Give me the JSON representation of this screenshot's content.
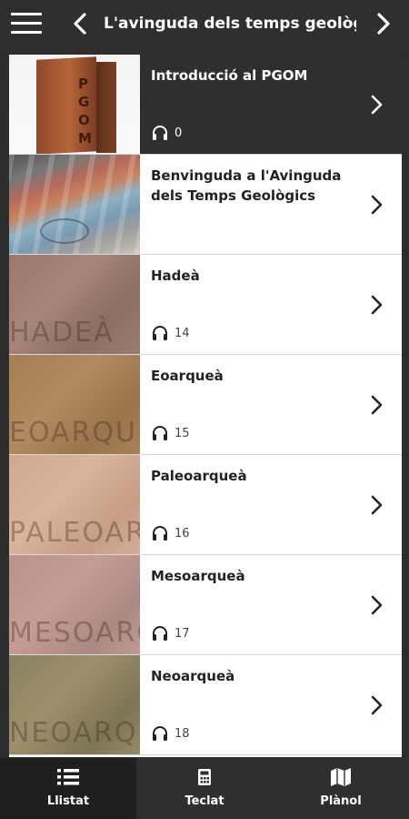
{
  "header": {
    "title": "L'avinguda dels temps geològics"
  },
  "items": [
    {
      "title": "Introducció al PGOM",
      "count": "0",
      "show_audio": true,
      "thumb": "pillar",
      "thumb_text": ""
    },
    {
      "title": "Benvinguda a l'Avinguda dels Temps Geològics",
      "count": "",
      "show_audio": false,
      "thumb": "avenue",
      "thumb_text": ""
    },
    {
      "title": "Hadeà",
      "count": "14",
      "show_audio": true,
      "thumb": "stone1",
      "thumb_text": "HADEÀ"
    },
    {
      "title": "Eoarqueà",
      "count": "15",
      "show_audio": true,
      "thumb": "stone2",
      "thumb_text": "EOARQUEÀ"
    },
    {
      "title": "Paleoarqueà",
      "count": "16",
      "show_audio": true,
      "thumb": "stone3",
      "thumb_text": "PALEOARQUEÀ"
    },
    {
      "title": "Mesoarqueà",
      "count": "17",
      "show_audio": true,
      "thumb": "stone4",
      "thumb_text": "MESOARQUEÀ"
    },
    {
      "title": "Neoarqueà",
      "count": "18",
      "show_audio": true,
      "thumb": "stone5",
      "thumb_text": "NEOARQUEÀ"
    }
  ],
  "tabs": [
    {
      "label": "Llistat",
      "icon": "list-icon",
      "active": true
    },
    {
      "label": "Teclat",
      "icon": "keypad-icon",
      "active": false
    },
    {
      "label": "Plànol",
      "icon": "map-icon",
      "active": false
    }
  ],
  "colors": {
    "bar": "#2f2f2f",
    "active_row": "#2f2f2f",
    "text": "#222222"
  }
}
